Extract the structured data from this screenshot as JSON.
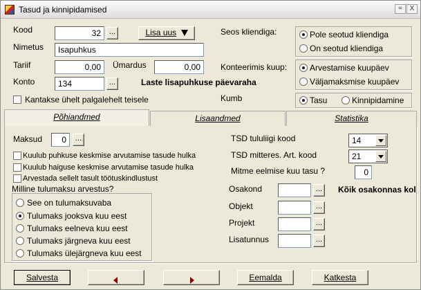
{
  "window": {
    "title": "Tasud ja kinnipidamised",
    "min_glyph": "=",
    "close_glyph": "X"
  },
  "form": {
    "kood_label": "Kood",
    "kood_value": "32",
    "lisa_uus_label": "Lisa uus",
    "nimetus_label": "Nimetus",
    "nimetus_value": "Isapuhkus",
    "tariif_label": "Tariif",
    "tariif_value": "0,00",
    "umardus_label": "Ümardus",
    "umardus_value": "0,00",
    "konto_label": "Konto",
    "konto_value": "134",
    "konto_desc": "Laste lisapuhkuse päevaraha",
    "kantakse_label": "Kantakse ühelt palgalehelt teisele",
    "dots": "..."
  },
  "seos": {
    "label": "Seos kliendiga:",
    "options": [
      "Pole seotud kliendiga",
      "On seotud kliendiga"
    ],
    "selected": 0
  },
  "konteerimis": {
    "label": "Konteerimis kuup:",
    "options": [
      "Arvestamise kuupäev",
      "Väljamaksmise kuupäev"
    ],
    "selected": 0
  },
  "kumb": {
    "label": "Kumb",
    "options": [
      "Tasu",
      "Kinnipidamine"
    ],
    "selected": 0
  },
  "tabs": [
    "Põhiandmed",
    "Lisaandmed",
    "Statistika"
  ],
  "pohiandmed": {
    "maksud_label": "Maksud",
    "maksud_value": "0",
    "checks": [
      "Kuulub puhkuse keskmise arvutamise tasude hulka",
      "Kuulub haiguse keskmise arvutamise tasude hulka",
      "Arvestada sellelt tasult töötuskindlustust"
    ],
    "tulumaks_label": "Milline tulumaksu arvestus?",
    "tulumaks_options": [
      "See on tulumaksuvaba",
      "Tulumaks jooksva kuu eest",
      "Tulumaks eelneva kuu eest",
      "Tulumaks järgneva kuu eest",
      "Tulumaks ülejärgneva kuu eest"
    ],
    "tulumaks_selected": 1,
    "tsd_liik_label": "TSD tululiigi kood",
    "tsd_liik_value": "14",
    "tsd_mitteres_label": "TSD mitteres. Art. kood",
    "tsd_mitteres_value": "21",
    "mitme_label": "Mitme eelmise kuu tasu ?",
    "mitme_value": "0",
    "osakond_label": "Osakond",
    "koik_label": "Kõik osakonnas kol",
    "objekt_label": "Objekt",
    "projekt_label": "Projekt",
    "lisatunnus_label": "Lisatunnus"
  },
  "buttons": {
    "salvesta": "Salvesta",
    "eemalda": "Eemalda",
    "katkesta": "Katkesta"
  }
}
